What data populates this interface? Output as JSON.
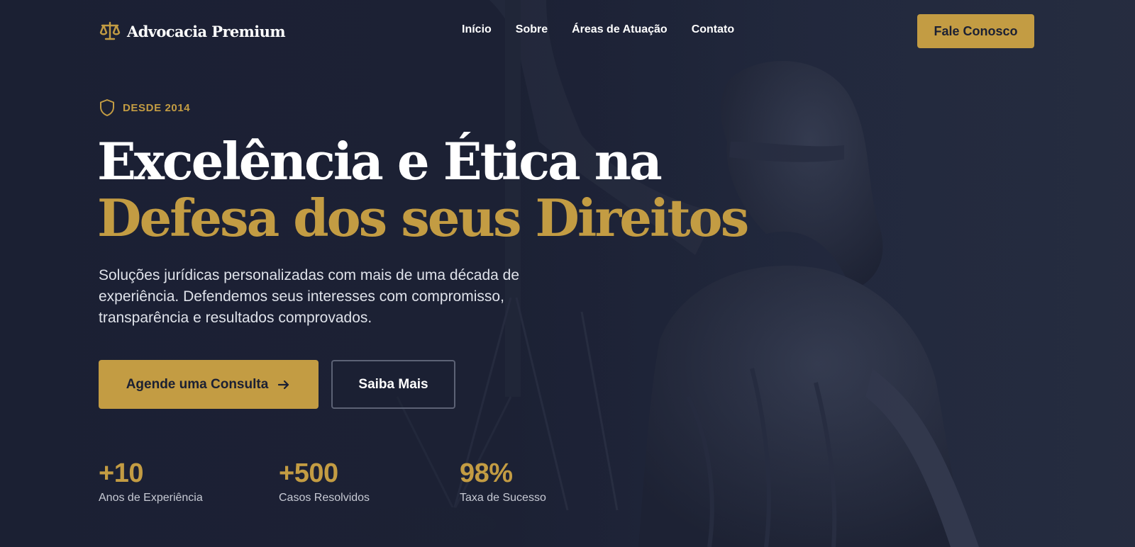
{
  "brand": {
    "name": "Advocacia Premium",
    "icon": "scales-icon",
    "accent": "#c39c43"
  },
  "nav": {
    "links": [
      "Início",
      "Sobre",
      "Áreas de Atuação",
      "Contato"
    ],
    "cta": "Fale Conosco"
  },
  "hero": {
    "badge": {
      "icon": "shield-icon",
      "text": "DESDE 2014"
    },
    "title_line1": "Excelência e Ética na",
    "title_line2": "Defesa dos seus Direitos",
    "lead": "Soluções jurídicas personalizadas com mais de uma década de experiência. Defendemos seus interesses com compromisso, transparência e resultados comprovados.",
    "primary_button": "Agende uma Consulta",
    "secondary_button": "Saiba Mais",
    "background": "lady-justice-statue-image"
  },
  "stats": [
    {
      "value": "+10",
      "label": "Anos de Experiência"
    },
    {
      "value": "+500",
      "label": "Casos Resolvidos"
    },
    {
      "value": "98%",
      "label": "Taxa de Sucesso"
    }
  ],
  "colors": {
    "background": "#1b2033",
    "gold": "#c39c43",
    "text": "#ffffff"
  }
}
